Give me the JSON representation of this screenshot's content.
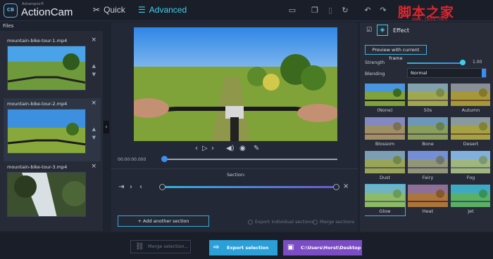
{
  "app": {
    "brand_small": "Ashampoo®",
    "brand": "ActionCam",
    "logo": "CB"
  },
  "modes": {
    "quick": "Quick",
    "advanced": "Advanced"
  },
  "watermark": {
    "text": "脚本之家",
    "url": "www.jb51.net"
  },
  "files": {
    "header": "Files",
    "items": [
      {
        "name": "mountain-bike-tour-1.mp4"
      },
      {
        "name": "mountain-bike-tour-2.mp4"
      },
      {
        "name": "mountain-bike-tour-3.mp4"
      }
    ]
  },
  "player": {
    "time": "00:00:00.000",
    "progress": 0
  },
  "section": {
    "label": "Section:",
    "add_label": "Add another section",
    "export_individual": "Export individual sections",
    "merge_sections": "Merge sections"
  },
  "effect": {
    "tab_label": "Effect",
    "preview_label": "Preview with current frame",
    "strength_label": "Strength",
    "strength_value": "1.00",
    "strength": 1.0,
    "blending_label": "Blending",
    "blending_value": "Normal",
    "filters": [
      "(None)",
      "50s",
      "Autumn",
      "Blossom",
      "Bone",
      "Desert",
      "Dust",
      "Fairy",
      "Fog",
      "Glow",
      "Heat",
      "Jet"
    ]
  },
  "bottom": {
    "merge_label": "Merge selection...",
    "export_label": "Export selection (1)",
    "path_label": "C:\\Users\\Horst\\Desktop"
  },
  "colors": {
    "accent": "#3fd0e8",
    "export": "#2a9fd8",
    "path": "#7b4cc4"
  }
}
